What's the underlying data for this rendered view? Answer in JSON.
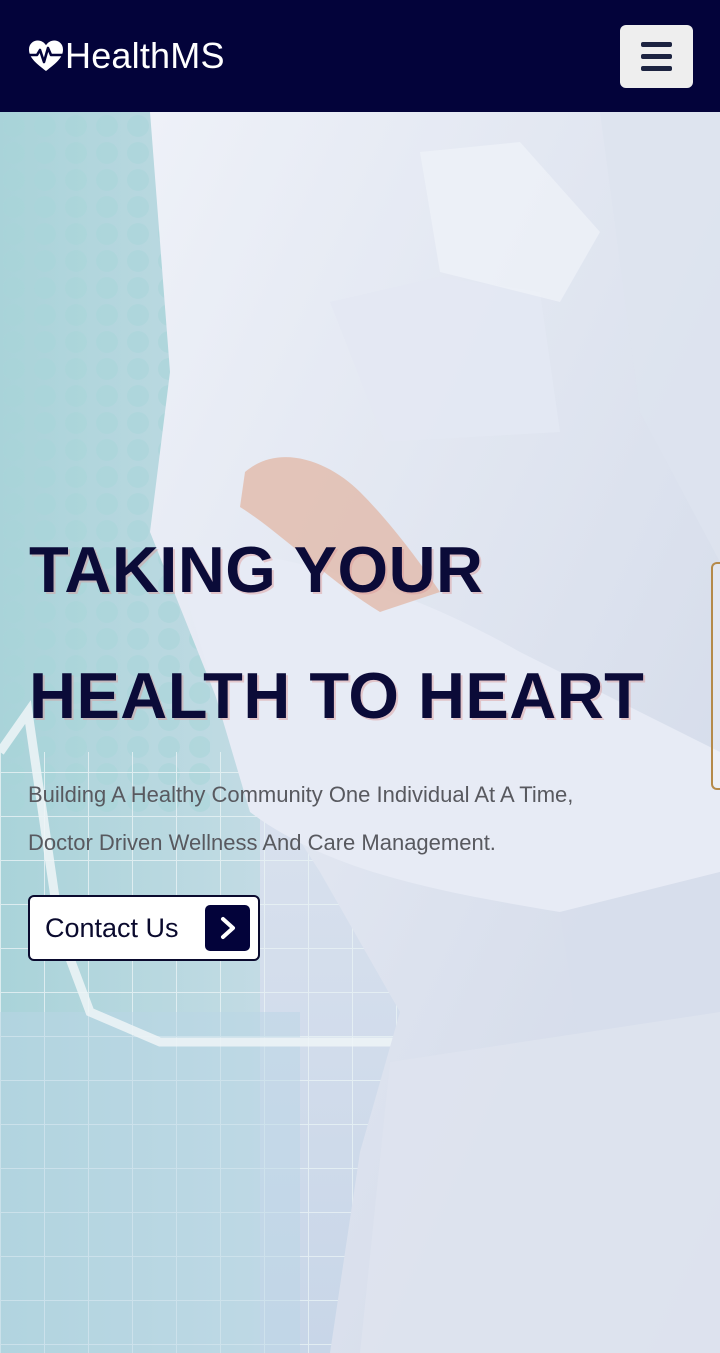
{
  "navbar": {
    "brand": "HealthMS",
    "brand_icon": "heart-pulse-icon",
    "menu_icon": "hamburger-menu-icon"
  },
  "hero": {
    "headline_line1": "TAKING YOUR",
    "headline_line2": "HEALTH TO HEART",
    "subline_line1": "Building A Healthy Community One Individual At A Time,",
    "subline_line2": "Doctor Driven Wellness And Care Management.",
    "cta_label": "Contact Us",
    "cta_icon": "chevron-right-icon"
  },
  "colors": {
    "navbar_bg": "#03033a",
    "headline": "#0b0b38",
    "subtext": "#58595f",
    "menu_button_bg": "#eeeeee"
  }
}
